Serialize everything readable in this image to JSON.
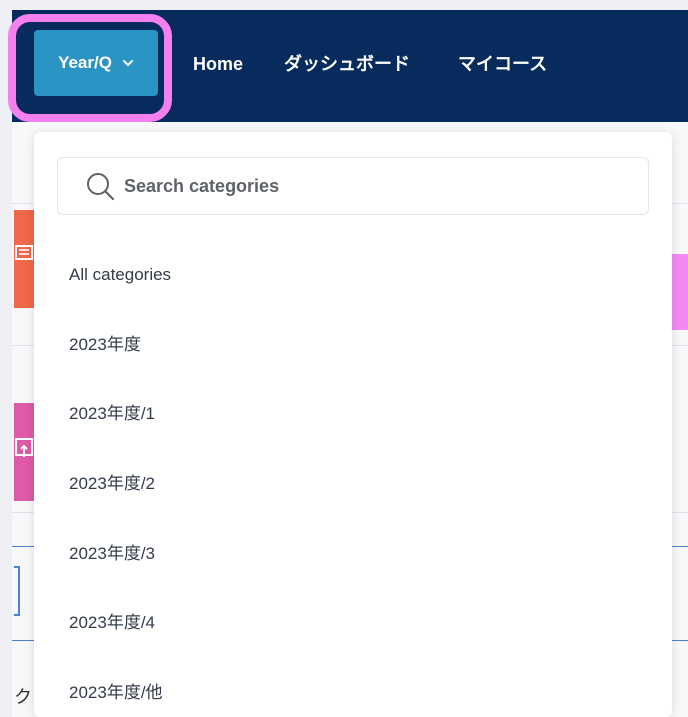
{
  "nav": {
    "year_button": "Year/Q",
    "links": [
      "Home",
      "ダッシュボード",
      "マイコース"
    ]
  },
  "search": {
    "placeholder": "Search categories"
  },
  "categories": [
    "All categories",
    "2023年度",
    "2023年度/1",
    "2023年度/2",
    "2023年度/3",
    "2023年度/4",
    "2023年度/他"
  ],
  "background": {
    "fragment_char": "ク"
  },
  "colors": {
    "navbar": "#072b5c",
    "year_button": "#2a95c4",
    "highlight": "#f480f0"
  },
  "icons": {
    "year_button": "chevron-down-icon",
    "search": "search-icon"
  }
}
